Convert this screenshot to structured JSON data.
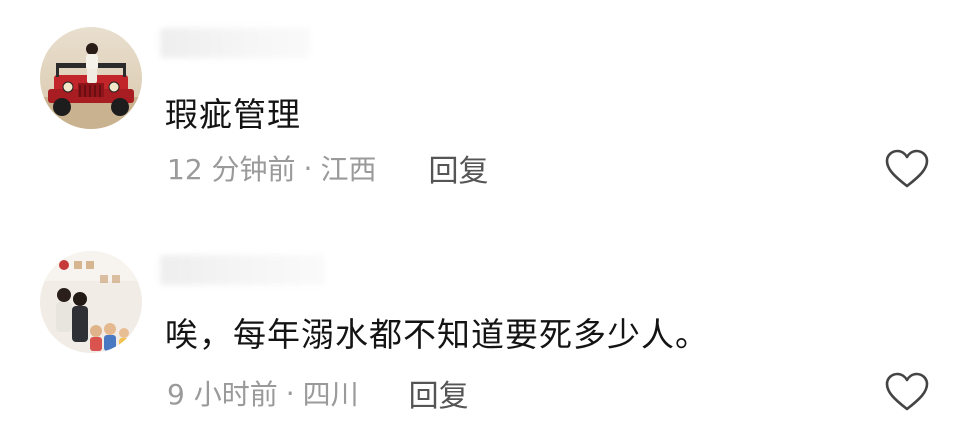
{
  "comments": [
    {
      "text": "瑕疵管理",
      "time": "12 分钟前",
      "separator": "·",
      "location": "江西",
      "reply_label": "回复",
      "avatar_icon": "avatar-red-jeep-photo",
      "like_icon": "heart-outline-icon"
    },
    {
      "text": "唉，每年溺水都不知道要死多少人。",
      "time": "9 小时前",
      "separator": "·",
      "location": "四川",
      "reply_label": "回复",
      "avatar_icon": "avatar-family-photo",
      "like_icon": "heart-outline-icon"
    }
  ],
  "colors": {
    "text_primary": "#141414",
    "text_meta": "#9a9a9a",
    "reply": "#555555",
    "icon_stroke": "#444444",
    "background": "#ffffff"
  }
}
